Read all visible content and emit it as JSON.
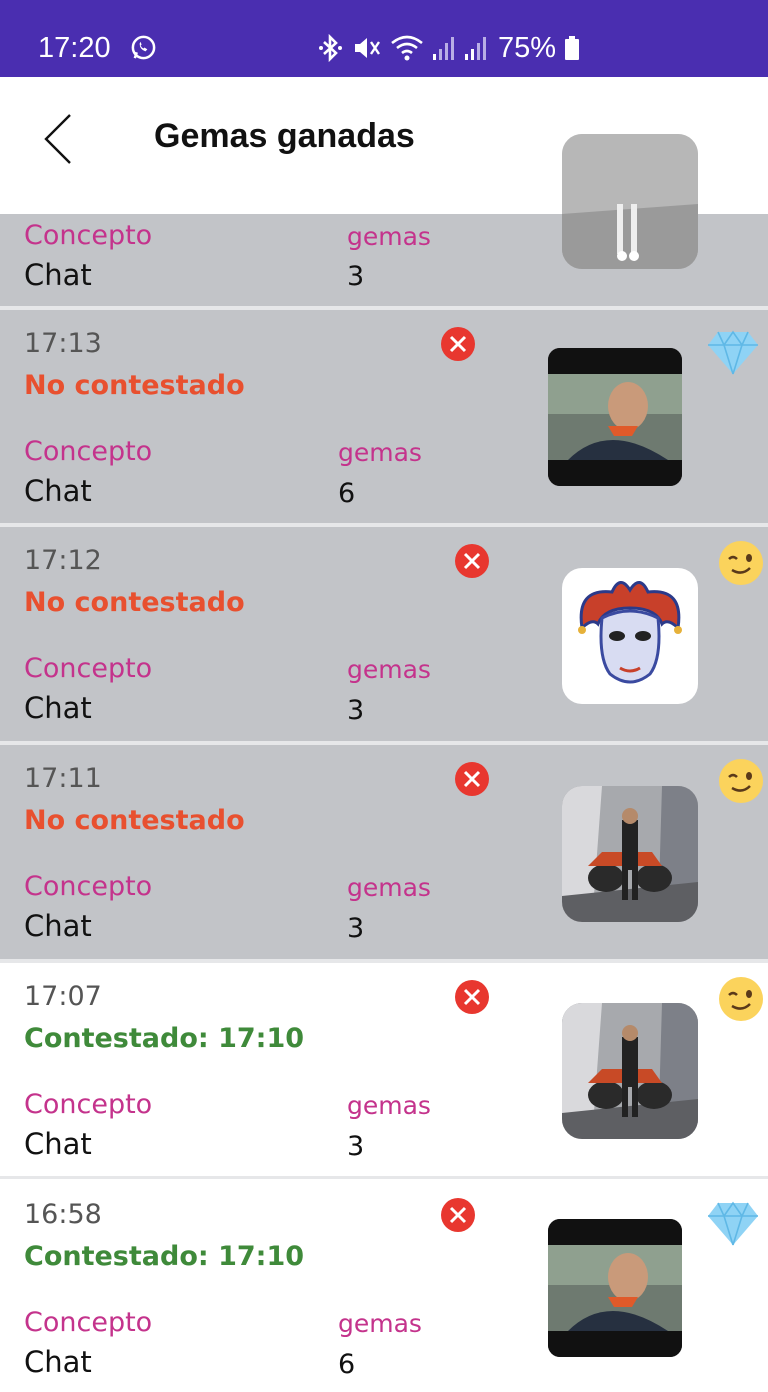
{
  "status_bar": {
    "time": "17:20",
    "battery": "75%",
    "icons": [
      "whatsapp-icon",
      "bluetooth-icon",
      "mute-icon",
      "wifi-icon",
      "signal-icon",
      "signal-icon",
      "battery-icon"
    ]
  },
  "header": {
    "title": "Gemas ganadas",
    "back_icon": "chevron-left-icon"
  },
  "colors": {
    "status_bar_bg": "#4a2eb0",
    "unanswered": "#e8502f",
    "answered": "#3f8a3a",
    "label": "#c4338c",
    "grey_row": "#c2c4c8"
  },
  "items": [
    {
      "time": "",
      "status": "",
      "concept_label": "Concepto",
      "concept": "Chat",
      "gems_label": "gemas",
      "gems": "3",
      "badge": "none"
    },
    {
      "time": "17:13",
      "status": "No contestado",
      "concept_label": "Concepto",
      "concept": "Chat",
      "gems_label": "gemas",
      "gems": "6",
      "badge": "diamond-icon"
    },
    {
      "time": "17:12",
      "status": "No contestado",
      "concept_label": "Concepto",
      "concept": "Chat",
      "gems_label": "gemas",
      "gems": "3",
      "badge": "wink-emoji-icon"
    },
    {
      "time": "17:11",
      "status": "No contestado",
      "concept_label": "Concepto",
      "concept": "Chat",
      "gems_label": "gemas",
      "gems": "3",
      "badge": "wink-emoji-icon"
    },
    {
      "time": "17:07",
      "status": "Contestado: 17:10",
      "concept_label": "Concepto",
      "concept": "Chat",
      "gems_label": "gemas",
      "gems": "3",
      "badge": "wink-emoji-icon"
    },
    {
      "time": "16:58",
      "status": "Contestado: 17:10",
      "concept_label": "Concepto",
      "concept": "Chat",
      "gems_label": "gemas",
      "gems": "6",
      "badge": "diamond-icon"
    }
  ]
}
